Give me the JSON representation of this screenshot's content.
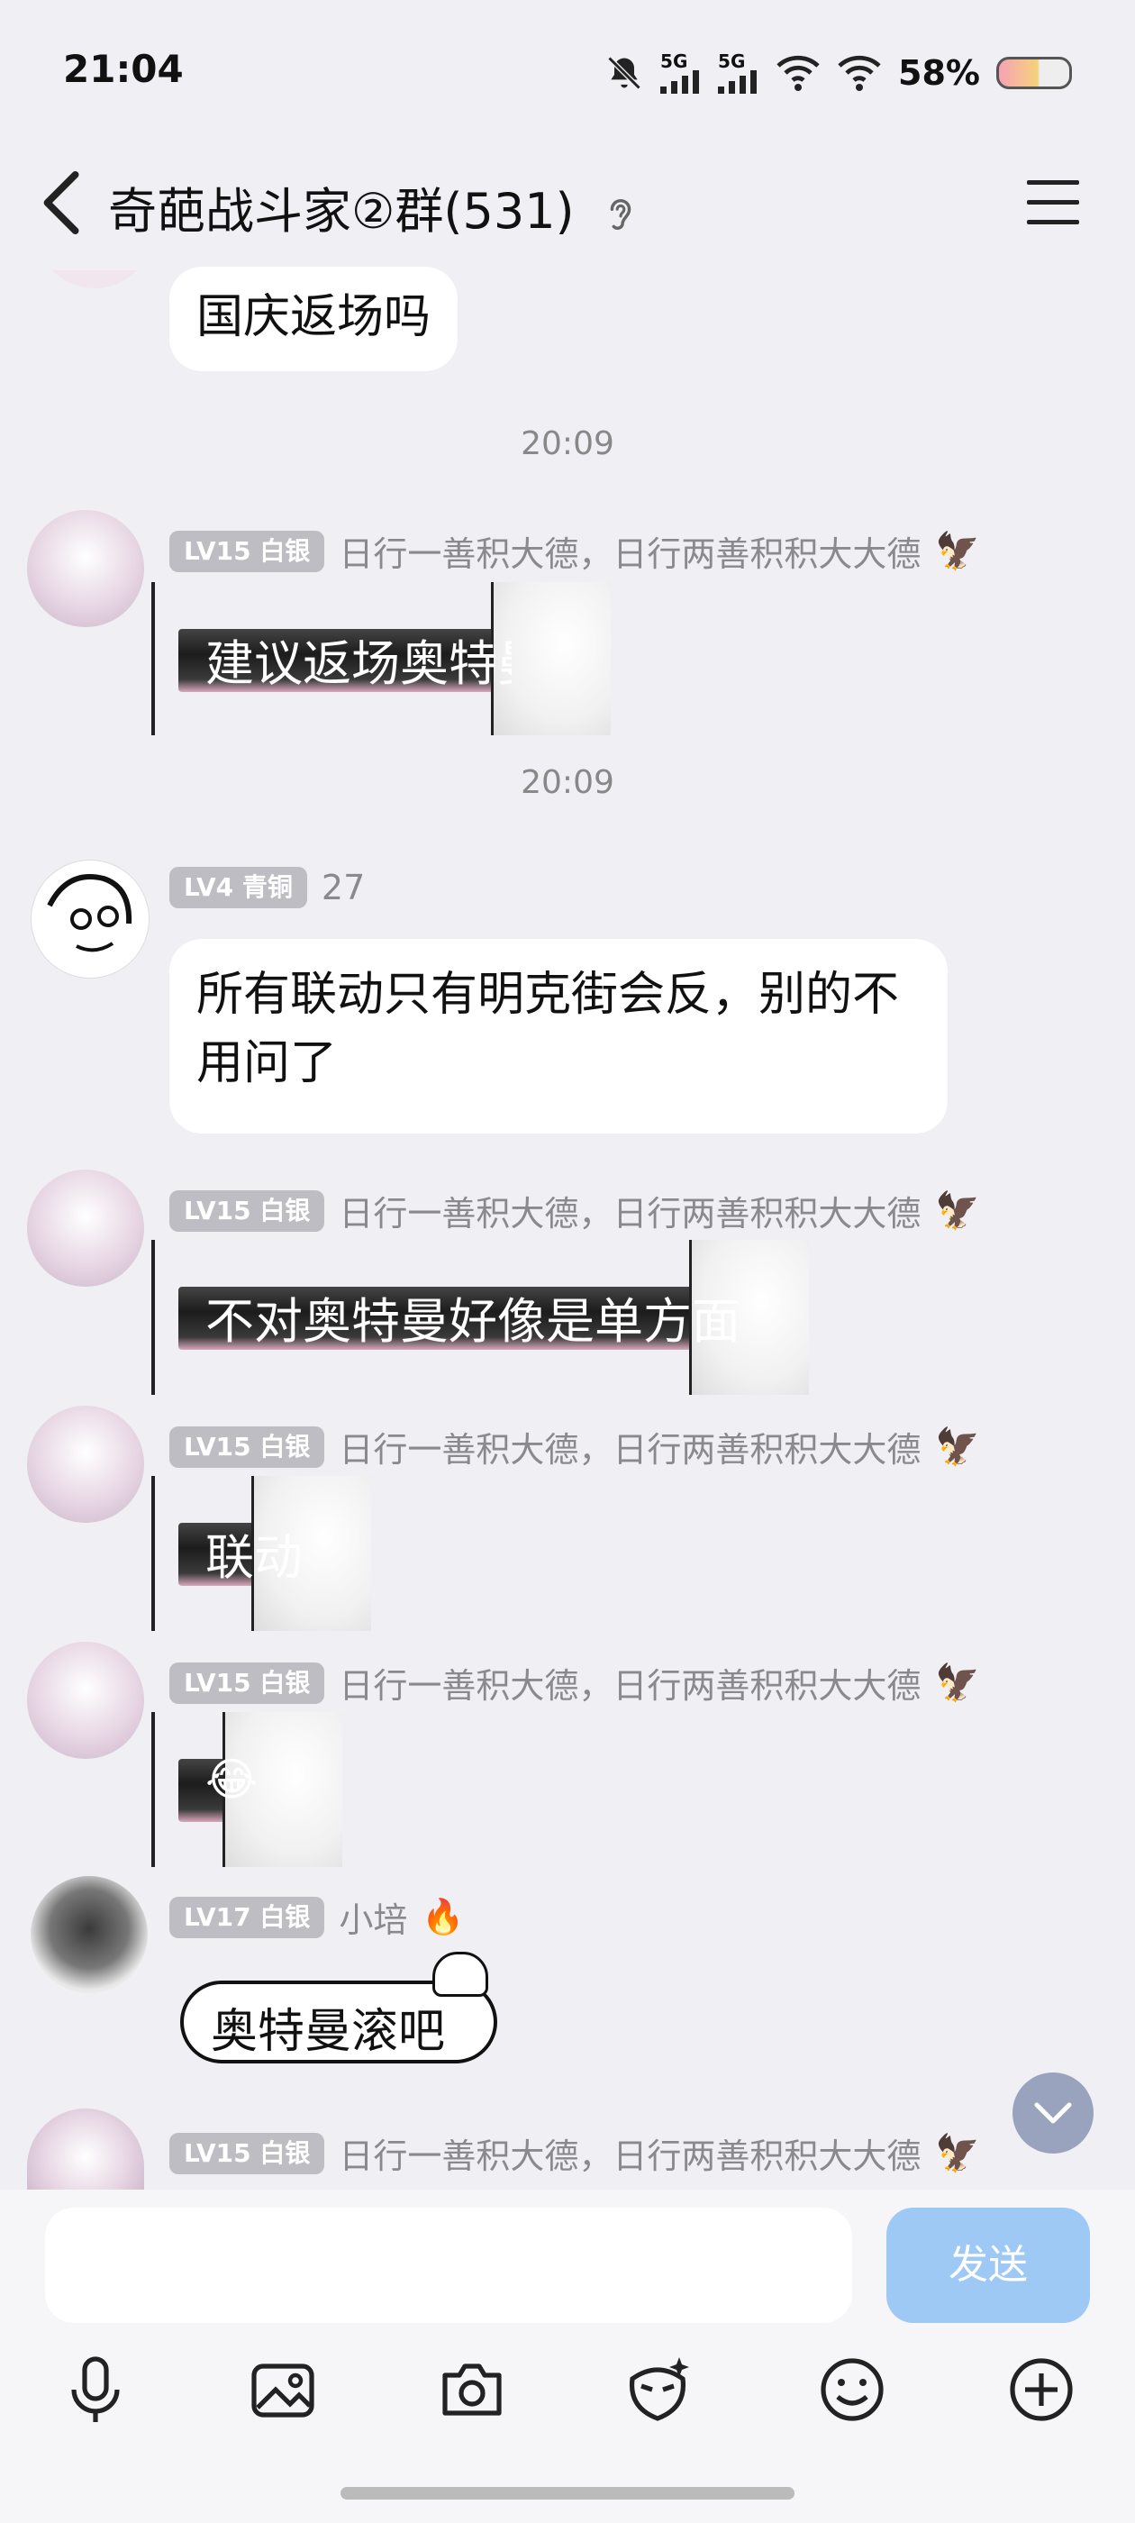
{
  "status_bar": {
    "time": "21:04",
    "network_1": "5G",
    "network_2": "5G",
    "battery": "58%"
  },
  "header": {
    "title": "奇葩战斗家②群(531)"
  },
  "messages": [
    {
      "type": "text",
      "text": "国庆返场吗"
    },
    {
      "type": "time",
      "text": "20:09"
    },
    {
      "type": "deco",
      "badge": "LV15 白银",
      "nick": "日行一善积大德，日行两善积积大大德",
      "text": "建议返场奥特曼"
    },
    {
      "type": "time",
      "text": "20:09"
    },
    {
      "type": "text",
      "badge": "LV4 青铜",
      "nick": "27",
      "text": "所有联动只有明克街会反，别的不用问了"
    },
    {
      "type": "deco",
      "badge": "LV15 白银",
      "nick": "日行一善积大德，日行两善积积大大德",
      "text": "不对奥特曼好像是单方面"
    },
    {
      "type": "deco",
      "badge": "LV15 白银",
      "nick": "日行一善积大德，日行两善积积大大德",
      "text": "联动"
    },
    {
      "type": "deco",
      "badge": "LV15 白银",
      "nick": "日行一善积大德，日行两善积积大大德",
      "text": "😂"
    },
    {
      "type": "sticker",
      "badge": "LV17 白银",
      "nick": "小培",
      "text": "奥特曼滚吧"
    },
    {
      "type": "partial",
      "badge": "LV15 白银",
      "nick": "日行一善积大德，日行两善积积大大德"
    }
  ],
  "input": {
    "send_label": "发送"
  },
  "toolbar": [
    "microphone-icon",
    "image-icon",
    "camera-icon",
    "sticker-icon",
    "emoji-icon",
    "plus-icon"
  ],
  "colors": {
    "background": "#efeff4",
    "send": "#9ec9f5",
    "badge": "#bdbdc3"
  }
}
